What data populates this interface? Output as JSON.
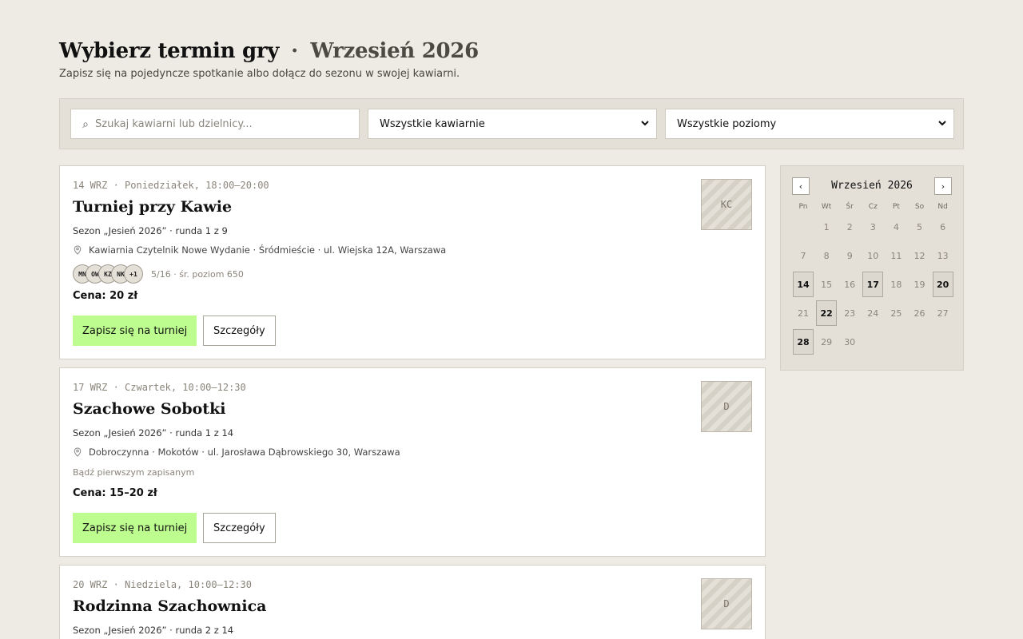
{
  "header": {
    "title": "Wybierz termin gry",
    "separator": "·",
    "month": "Wrzesień 2026",
    "subtitle": "Zapisz się na pojedyncze spotkanie albo dołącz do sezonu w swojej kawiarni."
  },
  "filters": {
    "search_placeholder": "Szukaj kawiarni lub dzielnicy...",
    "search_value": "",
    "cafe_selected": "Wszystkie kawiarnie",
    "level_selected": "Wszystkie poziomy"
  },
  "events": [
    {
      "date": "14 WRZ · Poniedziałek, 18:00–20:00",
      "title": "Turniej przy Kawie",
      "season": "Sezon „Jesień 2026” · runda 1 z 9",
      "address": "Kawiarnia Czytelnik Nowe Wydanie · Śródmieście · ul. Wiejska 12A, Warszawa",
      "avatars": [
        "MN",
        "OW",
        "KZ",
        "NK",
        "+1"
      ],
      "participants_meta": "5/16 · śr. poziom 650",
      "price": "Cena: 20 zł",
      "signup_label": "Zapisz się na turniej",
      "details_label": "Szczegóły",
      "thumb": "KC"
    },
    {
      "date": "17 WRZ · Czwartek, 10:00–12:30",
      "title": "Szachowe Sobotki",
      "season": "Sezon „Jesień 2026” · runda 1 z 14",
      "address": "Dobroczynna · Mokotów · ul. Jarosława Dąbrowskiego 30, Warszawa",
      "first_note": "Bądź pierwszym zapisanym",
      "price": "Cena: 15–20 zł",
      "signup_label": "Zapisz się na turniej",
      "details_label": "Szczegóły",
      "thumb": "D"
    },
    {
      "date": "20 WRZ · Niedziela, 10:00–12:30",
      "title": "Rodzinna Szachownica",
      "season": "Sezon „Jesień 2026” · runda 2 z 14",
      "thumb": "D"
    }
  ],
  "calendar": {
    "title": "Wrzesień 2026",
    "prev": "‹",
    "next": "›",
    "weekdays": [
      "Pn",
      "Wt",
      "Śr",
      "Cz",
      "Pt",
      "So",
      "Nd"
    ],
    "days": [
      {
        "d": "1",
        "active": false
      },
      {
        "d": "2",
        "active": false
      },
      {
        "d": "3",
        "active": false
      },
      {
        "d": "4",
        "active": false
      },
      {
        "d": "5",
        "active": false
      },
      {
        "d": "6",
        "active": false
      },
      {
        "d": "7",
        "active": false
      },
      {
        "d": "8",
        "active": false
      },
      {
        "d": "9",
        "active": false
      },
      {
        "d": "10",
        "active": false
      },
      {
        "d": "11",
        "active": false
      },
      {
        "d": "12",
        "active": false
      },
      {
        "d": "13",
        "active": false
      },
      {
        "d": "14",
        "active": true
      },
      {
        "d": "15",
        "active": false
      },
      {
        "d": "16",
        "active": false
      },
      {
        "d": "17",
        "active": true
      },
      {
        "d": "18",
        "active": false
      },
      {
        "d": "19",
        "active": false
      },
      {
        "d": "20",
        "active": true
      },
      {
        "d": "21",
        "active": false
      },
      {
        "d": "22",
        "active": true
      },
      {
        "d": "23",
        "active": false
      },
      {
        "d": "24",
        "active": false
      },
      {
        "d": "25",
        "active": false
      },
      {
        "d": "26",
        "active": false
      },
      {
        "d": "27",
        "active": false
      },
      {
        "d": "28",
        "active": true
      },
      {
        "d": "29",
        "active": false
      },
      {
        "d": "30",
        "active": false
      }
    ]
  },
  "icons": {
    "search": "search-icon",
    "pin": "map-pin-icon",
    "chevron": "chevron-down-icon"
  },
  "colors": {
    "background": "#eeebe4",
    "panel": "#e4e0d8",
    "accent": "#bdfc8e"
  }
}
